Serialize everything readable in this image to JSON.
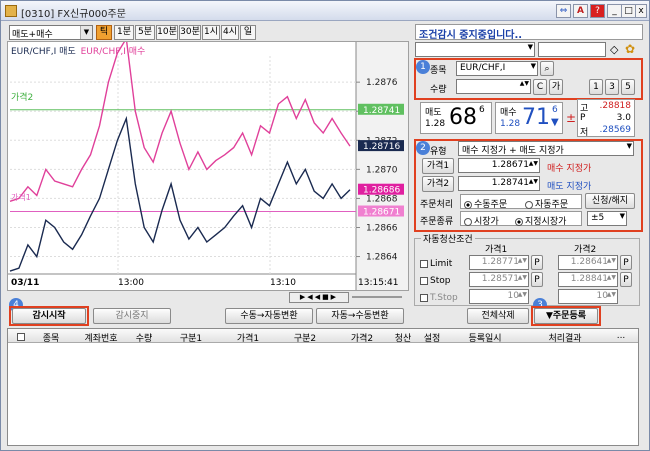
{
  "window": {
    "title": "[0310] FX신규000주문",
    "title_icons": [
      "⇔",
      "A",
      "?"
    ],
    "min": "_",
    "max": "□",
    "close": "x"
  },
  "toolbar": {
    "pair_mode": "매도+매수",
    "periods": [
      "틱",
      "1분",
      "5분",
      "10분",
      "30분",
      "1시",
      "4시",
      "일"
    ],
    "active_period": "틱"
  },
  "chart": {
    "legend_sell": "EUR/CHF,I 매도",
    "legend_buy": "EUR/CHF,I 매수",
    "price2_label": "가격2",
    "price1_label": "가격1",
    "date_label": "03/11",
    "time_labels": [
      "13:00",
      "13:10"
    ],
    "clock": "13:15:41"
  },
  "chart_data": {
    "type": "line",
    "series": [
      {
        "name": "EUR/CHF,I 매도",
        "color": "#1a2a50",
        "values": [
          1.2863,
          1.28632,
          1.28648,
          1.2864,
          1.28665,
          1.2866,
          1.2865,
          1.28645,
          1.28655,
          1.28668,
          1.2868,
          1.287,
          1.2872,
          1.28735,
          1.2869,
          1.2866,
          1.2865,
          1.28672,
          1.2869,
          1.28665,
          1.28652,
          1.2866,
          1.2865,
          1.28655,
          1.2866,
          1.28668,
          1.28675,
          1.2866,
          1.2868,
          1.28675,
          1.2869,
          1.28705,
          1.2869,
          1.287,
          1.28685,
          1.2868,
          1.2869,
          1.2868,
          1.28686
        ]
      },
      {
        "name": "EUR/CHF,I 매수",
        "color": "#e0409a",
        "values": [
          1.28678,
          1.2868,
          1.28688,
          1.28682,
          1.287,
          1.28692,
          1.2869,
          1.28688,
          1.287,
          1.2871,
          1.2873,
          1.2876,
          1.2878,
          1.2879,
          1.2874,
          1.28715,
          1.28705,
          1.28725,
          1.2874,
          1.28718,
          1.287,
          1.28712,
          1.287,
          1.28706,
          1.2871,
          1.28715,
          1.28725,
          1.2871,
          1.2873,
          1.28725,
          1.28745,
          1.2875,
          1.28735,
          1.28748,
          1.28732,
          1.28725,
          1.28735,
          1.28725,
          1.28716
        ]
      }
    ],
    "y_ticks": [
      1.2876,
      1.2874,
      1.2872,
      1.287,
      1.2868,
      1.2866,
      1.2864
    ],
    "ylim": [
      1.28628,
      1.28778
    ],
    "price_tags": [
      {
        "label": "1.28741",
        "value": 1.28741,
        "kind": "price2"
      },
      {
        "label": "1.28716",
        "value": 1.28716,
        "kind": "last-buy"
      },
      {
        "label": "1.28686",
        "value": 1.28686,
        "kind": "last-sell"
      },
      {
        "label": "1.28671",
        "value": 1.28671,
        "kind": "price1"
      }
    ],
    "grid": true
  },
  "right": {
    "status": "조건감시 중지중입니다..",
    "item_label": "종목",
    "item_value": "EUR/CHF,I",
    "qty_label": "수량",
    "qty_c": "C",
    "qty_ga": "가",
    "qty_presets": [
      "1",
      "3",
      "5"
    ],
    "sell_label": "매도",
    "sell_small": "1.28",
    "sell_big": "68",
    "sell_sup": "6",
    "buy_label": "매수",
    "buy_small": "1.28",
    "buy_big": "71",
    "buy_sup": "6",
    "high_label": "고",
    "high_value": ".28818",
    "p_label": "P",
    "p_value": "3.0",
    "low_label": "저",
    "low_value": ".28569",
    "type_label": "유형",
    "type_value": "매수 지정가 + 매도 지정가",
    "price1_label": "가격1",
    "price1_value": "1.28671",
    "price1_note": "매수 지정가",
    "price2_label": "가격2",
    "price2_value": "1.28741",
    "price2_note": "매도 지정가",
    "proc_label": "주문처리",
    "proc_opt1": "수동주문",
    "proc_opt2": "자동주문",
    "proc_btn": "신청/해지",
    "kind_label": "주문종류",
    "kind_opt1": "시장가",
    "kind_opt2": "지정시장가",
    "kind_range": "±5",
    "auto_group": "자동청산조건",
    "col_price1": "가격1",
    "col_price2": "가격2",
    "limit_label": "Limit",
    "limit_p1": "1.28771",
    "limit_p2": "1.28641",
    "stop_label": "Stop",
    "stop_p1": "1.28571",
    "stop_p2": "1.28841",
    "tstop_label": "T.Stop",
    "tstop_p1": "10",
    "tstop_p2": "10",
    "p_btn": "P"
  },
  "buttons": {
    "watch_start": "감시시작",
    "watch_stop": "감시중지",
    "manual_to_auto": "수동→자동변환",
    "auto_to_manual": "자동→수동변환",
    "delete_all": "전체삭제",
    "order_register": "▼주문등록"
  },
  "markers": [
    "1",
    "2",
    "3",
    "4"
  ],
  "grid": {
    "columns": [
      "종목",
      "계좌번호",
      "수량",
      "구분1",
      "가격1",
      "구분2",
      "가격2",
      "청산",
      "설정",
      "등록일시",
      "처리결과"
    ],
    "more": "..."
  }
}
